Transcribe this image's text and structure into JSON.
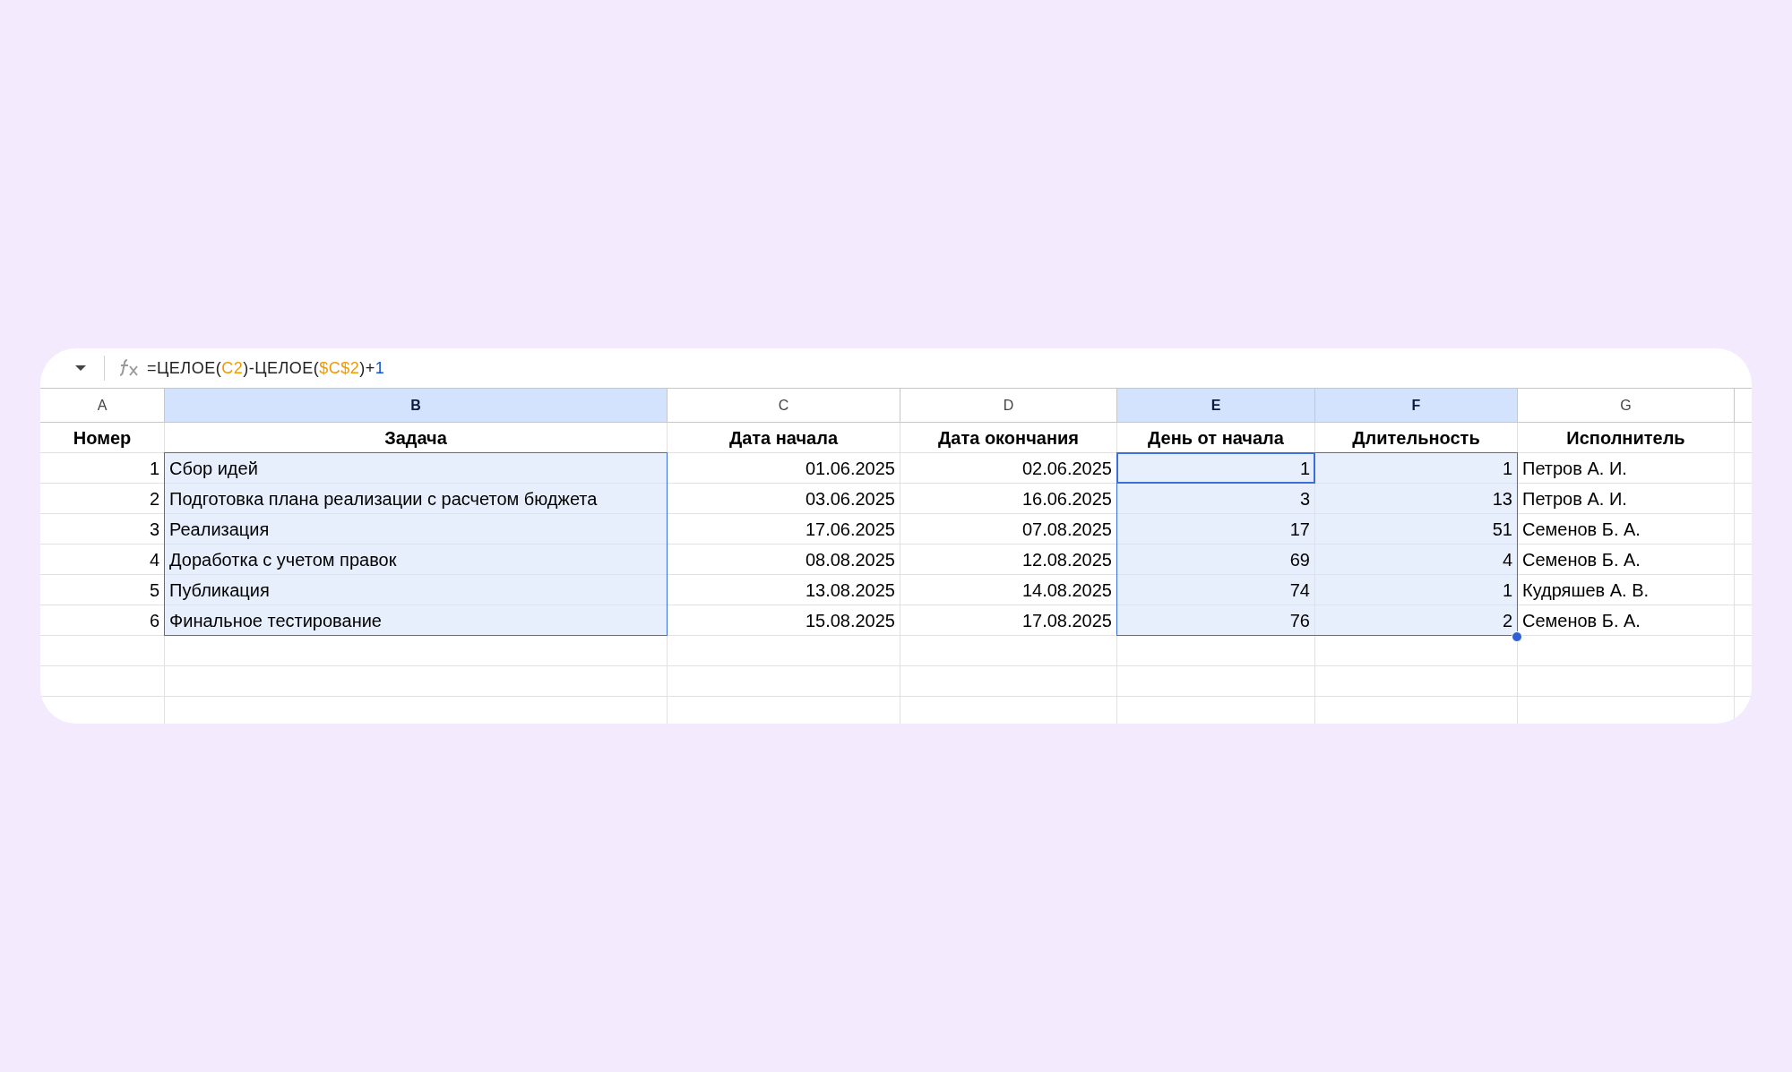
{
  "formula_bar": {
    "formula": [
      {
        "text": "=ЦЕЛОЕ(",
        "color": "#1f1f1f"
      },
      {
        "text": "C2",
        "color": "#f29900"
      },
      {
        "text": ")-ЦЕЛОЕ(",
        "color": "#1f1f1f"
      },
      {
        "text": "$C$2",
        "color": "#f29900"
      },
      {
        "text": ")+",
        "color": "#1f1f1f"
      },
      {
        "text": "1",
        "color": "#1155cc"
      }
    ]
  },
  "columns": [
    {
      "label": "A",
      "selected": false,
      "kind": "number"
    },
    {
      "label": "B",
      "selected": true,
      "kind": "text"
    },
    {
      "label": "C",
      "selected": false,
      "kind": "number"
    },
    {
      "label": "D",
      "selected": false,
      "kind": "number"
    },
    {
      "label": "E",
      "selected": true,
      "kind": "number"
    },
    {
      "label": "F",
      "selected": true,
      "kind": "number"
    },
    {
      "label": "G",
      "selected": false,
      "kind": "text"
    }
  ],
  "header_row": [
    "Номер",
    "Задача",
    "Дата начала",
    "Дата окончания",
    "День от начала",
    "Длительность",
    "Исполнитель"
  ],
  "rows": [
    {
      "cells": [
        {
          "text": "1",
          "selected": false,
          "active": false
        },
        {
          "text": "Сбор идей",
          "selected": true,
          "active": false
        },
        {
          "text": "01.06.2025",
          "selected": false,
          "active": false
        },
        {
          "text": "02.06.2025",
          "selected": false,
          "active": false
        },
        {
          "text": "1",
          "selected": true,
          "active": true
        },
        {
          "text": "1",
          "selected": true,
          "active": false
        },
        {
          "text": "Петров А. И.",
          "selected": false,
          "active": false
        }
      ]
    },
    {
      "cells": [
        {
          "text": "2",
          "selected": false,
          "active": false
        },
        {
          "text": "Подготовка плана реализации с расчетом бюджета",
          "selected": true,
          "active": false
        },
        {
          "text": "03.06.2025",
          "selected": false,
          "active": false
        },
        {
          "text": "16.06.2025",
          "selected": false,
          "active": false
        },
        {
          "text": "3",
          "selected": true,
          "active": false
        },
        {
          "text": "13",
          "selected": true,
          "active": false
        },
        {
          "text": "Петров А. И.",
          "selected": false,
          "active": false
        }
      ]
    },
    {
      "cells": [
        {
          "text": "3",
          "selected": false,
          "active": false
        },
        {
          "text": "Реализация",
          "selected": true,
          "active": false
        },
        {
          "text": "17.06.2025",
          "selected": false,
          "active": false
        },
        {
          "text": "07.08.2025",
          "selected": false,
          "active": false
        },
        {
          "text": "17",
          "selected": true,
          "active": false
        },
        {
          "text": "51",
          "selected": true,
          "active": false
        },
        {
          "text": "Семенов Б. А.",
          "selected": false,
          "active": false
        }
      ]
    },
    {
      "cells": [
        {
          "text": "4",
          "selected": false,
          "active": false
        },
        {
          "text": "Доработка с учетом правок",
          "selected": true,
          "active": false
        },
        {
          "text": "08.08.2025",
          "selected": false,
          "active": false
        },
        {
          "text": "12.08.2025",
          "selected": false,
          "active": false
        },
        {
          "text": "69",
          "selected": true,
          "active": false
        },
        {
          "text": "4",
          "selected": true,
          "active": false
        },
        {
          "text": "Семенов Б. А.",
          "selected": false,
          "active": false
        }
      ]
    },
    {
      "cells": [
        {
          "text": "5",
          "selected": false,
          "active": false
        },
        {
          "text": "Публикация",
          "selected": true,
          "active": false
        },
        {
          "text": "13.08.2025",
          "selected": false,
          "active": false
        },
        {
          "text": "14.08.2025",
          "selected": false,
          "active": false
        },
        {
          "text": "74",
          "selected": true,
          "active": false
        },
        {
          "text": "1",
          "selected": true,
          "active": false
        },
        {
          "text": "Кудряшев А. В.",
          "selected": false,
          "active": false
        }
      ]
    },
    {
      "cells": [
        {
          "text": "6",
          "selected": false,
          "active": false
        },
        {
          "text": "Финальное тестирование",
          "selected": true,
          "active": false
        },
        {
          "text": "15.08.2025",
          "selected": false,
          "active": false
        },
        {
          "text": "17.08.2025",
          "selected": false,
          "active": false
        },
        {
          "text": "76",
          "selected": true,
          "active": false
        },
        {
          "text": "2",
          "selected": true,
          "active": false
        },
        {
          "text": "Семенов Б. А.",
          "selected": false,
          "active": false
        }
      ]
    }
  ]
}
